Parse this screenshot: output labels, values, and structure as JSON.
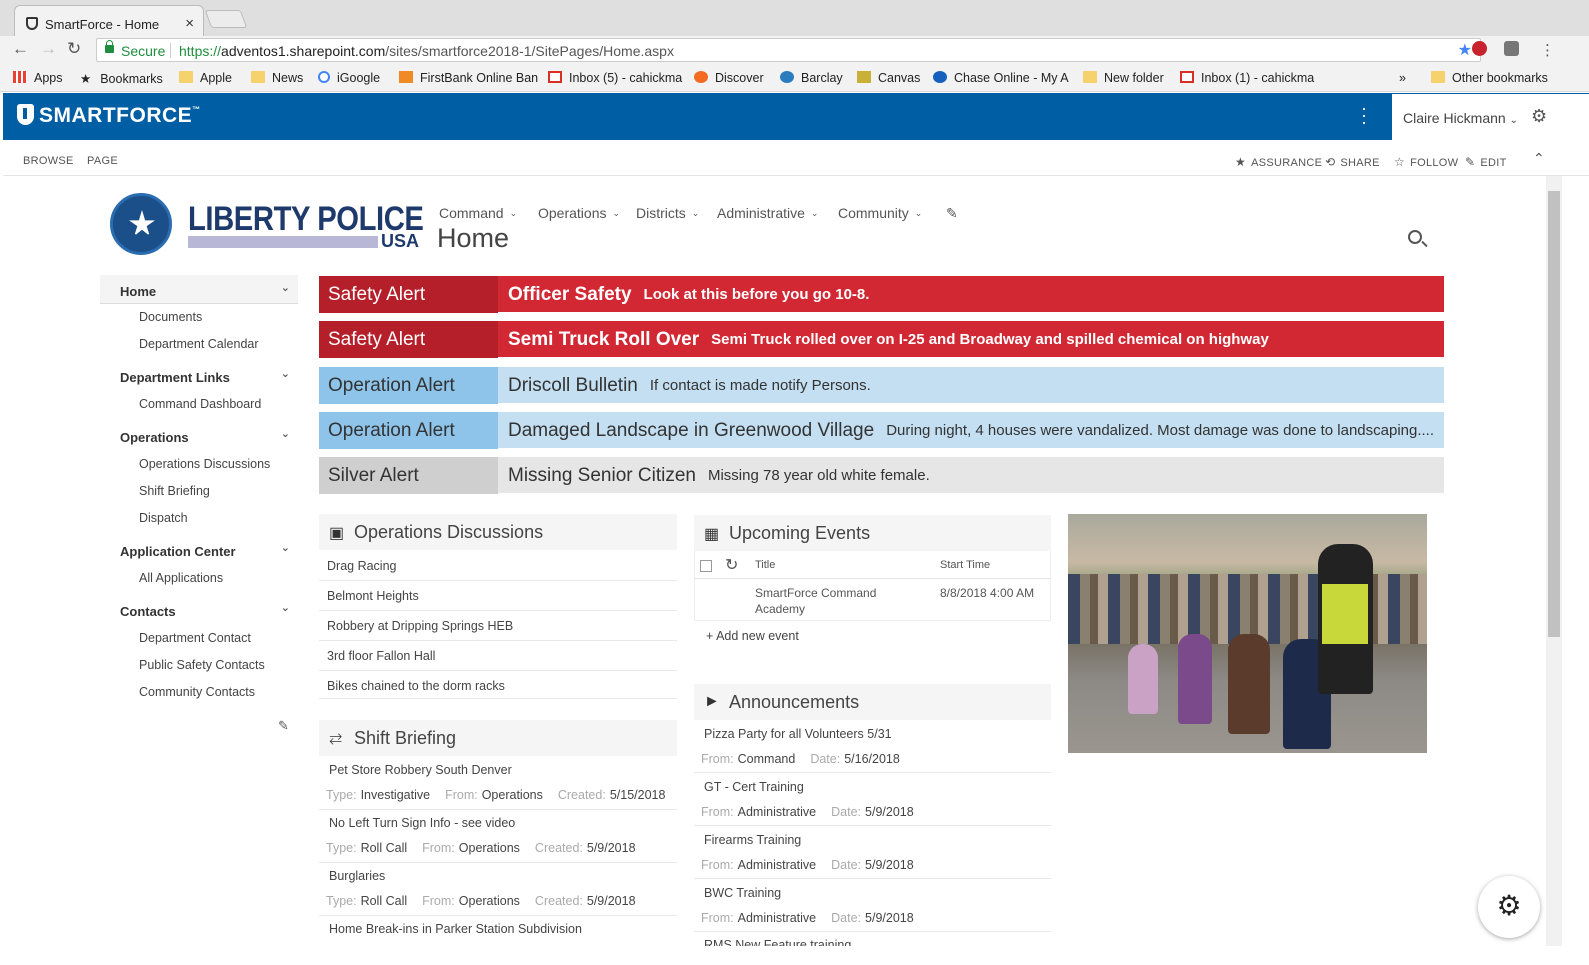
{
  "browser": {
    "tab_title": "SmartForce - Home",
    "tab_close": "×",
    "secure_label": "Secure",
    "url_scheme": "https://",
    "url_domain": "adventos1.sharepoint.com",
    "url_path": "/sites/smartforce2018-1/SitePages/Home.aspx",
    "bookmarks": [
      "Apps",
      "Bookmarks",
      "Apple",
      "News",
      "iGoogle",
      "FirstBank Online Ban",
      "Inbox (5) - cahickma",
      "Discover",
      "Barclay",
      "Canvas",
      "Chase Online - My A",
      "New folder",
      "Inbox (1) - cahickma"
    ],
    "bookmarks_more": "»",
    "other_bookmarks": "Other bookmarks"
  },
  "suite": {
    "logo": "SMARTFORCE",
    "user_name": "Claire Hickmann",
    "icon_more": "more-vertical-icon",
    "icon_settings": "gear-icon"
  },
  "ribbon": {
    "tabs": [
      "BROWSE",
      "PAGE"
    ],
    "actions": [
      "ASSURANCE",
      "SHARE",
      "FOLLOW",
      "EDIT"
    ]
  },
  "site": {
    "logo_main": "LIBERTY POLICE",
    "logo_sub": "USA",
    "nav": [
      "Command",
      "Operations",
      "Districts",
      "Administrative",
      "Community"
    ],
    "page_title": "Home"
  },
  "leftnav": {
    "groups": [
      {
        "label": "Home",
        "items": [
          "Documents",
          "Department Calendar"
        ]
      },
      {
        "label": "Department Links",
        "items": [
          "Command Dashboard"
        ]
      },
      {
        "label": "Operations",
        "items": [
          "Operations Discussions",
          "Shift Briefing",
          "Dispatch"
        ]
      },
      {
        "label": "Application Center",
        "items": [
          "All Applications"
        ]
      },
      {
        "label": "Contacts",
        "items": [
          "Department Contact",
          "Public Safety Contacts",
          "Community Contacts"
        ]
      }
    ]
  },
  "alerts": [
    {
      "type": "Safety Alert",
      "title": "Officer Safety",
      "desc": "Look at this before you go 10-8.",
      "color": "#d22834"
    },
    {
      "type": "Safety Alert",
      "title": "Semi Truck Roll Over",
      "desc": "Semi Truck rolled over on I-25 and Broadway and spilled chemical on highway",
      "color": "#d22834"
    },
    {
      "type": "Operation Alert",
      "title": "Driscoll Bulletin",
      "desc": "If contact is made notify Persons.",
      "color": "#c3dff1"
    },
    {
      "type": "Operation Alert",
      "title": "Damaged Landscape in Greenwood Village",
      "desc": "During night, 4 houses were vandalized. Most damage was done to landscaping....",
      "color": "#c3dff1"
    },
    {
      "type": "Silver Alert",
      "title": "Missing Senior Citizen",
      "desc": "Missing 78 year old white female.",
      "color": "#e6e6e6"
    }
  ],
  "discussions": {
    "title": "Operations Discussions",
    "items": [
      "Drag Racing",
      "Belmont Heights",
      "Robbery at Dripping Springs HEB",
      "3rd floor Fallon Hall",
      "Bikes chained to the dorm racks"
    ]
  },
  "shift": {
    "title": "Shift Briefing",
    "labels": {
      "type": "Type:",
      "from": "From:",
      "created": "Created:"
    },
    "items": [
      {
        "title": "Pet Store Robbery South Denver",
        "type": "Investigative",
        "from": "Operations",
        "created": "5/15/2018"
      },
      {
        "title": "No Left Turn Sign Info - see video",
        "type": "Roll Call",
        "from": "Operations",
        "created": "5/9/2018"
      },
      {
        "title": "Burglaries",
        "type": "Roll Call",
        "from": "Operations",
        "created": "5/9/2018"
      },
      {
        "title": "Home Break-ins in Parker Station Subdivision"
      }
    ]
  },
  "events": {
    "title": "Upcoming Events",
    "col_title": "Title",
    "col_start": "Start Time",
    "rows": [
      {
        "title": "SmartForce Command Academy",
        "start": "8/8/2018 4:00 AM"
      }
    ],
    "add_label": "Add new event"
  },
  "announcements": {
    "title": "Announcements",
    "labels": {
      "from": "From:",
      "date": "Date:"
    },
    "items": [
      {
        "title": "Pizza Party for all Volunteers 5/31",
        "from": "Command",
        "date": "5/16/2018"
      },
      {
        "title": "GT - Cert Training",
        "from": "Administrative",
        "date": "5/9/2018"
      },
      {
        "title": "Firearms Training",
        "from": "Administrative",
        "date": "5/9/2018"
      },
      {
        "title": "BWC Training",
        "from": "Administrative",
        "date": "5/9/2018"
      },
      {
        "title": "RMS New Feature training"
      }
    ]
  }
}
